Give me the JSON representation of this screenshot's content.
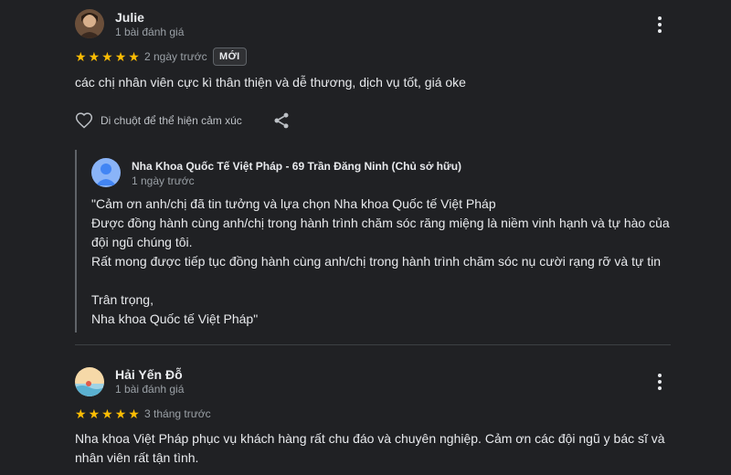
{
  "reviews": [
    {
      "author": "Julie",
      "review_count": "1 bài đánh giá",
      "rating": 5,
      "time": "2 ngày trước",
      "badge": "MỚI",
      "text": "các chị nhân viên cực kì thân thiện và dễ thương, dịch vụ tốt, giá oke",
      "like_label": "Di chuột để thể hiện cảm xúc",
      "icons": {
        "more": "more-vert-icon",
        "like": "heart-icon",
        "share": "share-icon"
      },
      "owner_reply": {
        "owner_name": "Nha Khoa Quốc Tế Việt Pháp - 69 Trần Đăng Ninh (Chủ sở hữu)",
        "time": "1 ngày trước",
        "lines": [
          "\"Cảm ơn anh/chị đã tin tưởng và lựa chọn Nha khoa Quốc tế Việt Pháp",
          "Được đồng hành cùng anh/chị trong hành trình chăm sóc răng miệng là niềm vinh hạnh và tự hào của",
          "đội ngũ chúng tôi.",
          "Rất mong được tiếp tục đồng hành cùng anh/chị trong hành trình chăm sóc nụ cười rạng rỡ và tự tin",
          "",
          "Trân trọng,",
          "Nha khoa Quốc tế Việt Pháp\""
        ]
      }
    },
    {
      "author": "Hải Yến Đỗ",
      "review_count": "1 bài đánh giá",
      "rating": 5,
      "time": "3 tháng trước",
      "text_lines": [
        "Nha khoa Việt Pháp phục vụ khách hàng rất chu đáo và chuyên nghiệp. Cảm ơn các đội ngũ y bác sĩ và",
        "nhân viên rất tận tình."
      ]
    }
  ],
  "colors": {
    "background": "#202124",
    "star": "#fbbc04",
    "text": "#e8eaed",
    "muted": "#9aa0a6"
  }
}
